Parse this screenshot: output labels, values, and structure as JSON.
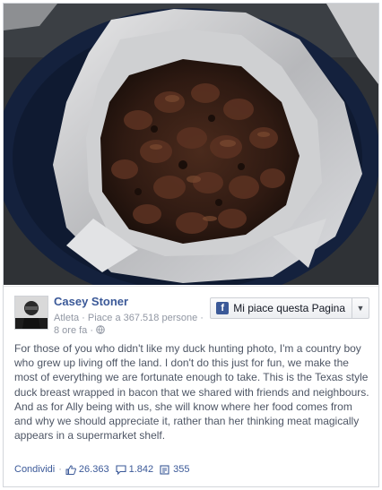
{
  "post": {
    "author": "Casey Stoner",
    "meta": "Atleta · Piace a 367.518 persone · 8 ore fa ·",
    "like_page_button": "Mi piace questa Pagina",
    "body": "For those of you who didn't like my duck hunting photo, I'm a country boy who grew up living off the land. I don't do this just for fun, we make the most of everything we are fortunate enough to take. This is the Texas style duck breast wrapped in bacon that we shared with friends and neighbours. And as for Ally being with us, she will know where her food comes from and why we should appreciate it, rather than her thinking meat magically appears in a supermarket shelf.",
    "share_label": "Condividi",
    "likes": "26.363",
    "comments": "1.842",
    "shares": "355"
  },
  "icons": {
    "globe": "globe-icon",
    "facebook": "facebook-f-icon",
    "thumb": "thumbs-up-icon",
    "comment": "comment-icon",
    "share": "share-icon",
    "dropdown": "chevron-down-icon"
  },
  "colors": {
    "link_blue": "#3b5998",
    "meta_gray": "#9197a3",
    "body_text": "#4e5665"
  }
}
